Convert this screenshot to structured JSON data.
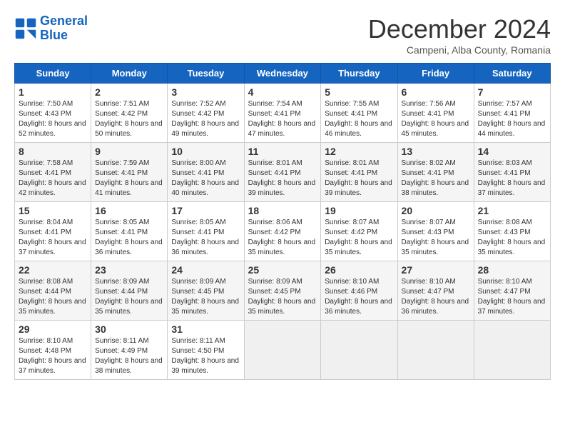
{
  "header": {
    "logo_line1": "General",
    "logo_line2": "Blue",
    "title": "December 2024",
    "subtitle": "Campeni, Alba County, Romania"
  },
  "weekdays": [
    "Sunday",
    "Monday",
    "Tuesday",
    "Wednesday",
    "Thursday",
    "Friday",
    "Saturday"
  ],
  "weeks": [
    [
      {
        "day": "1",
        "sunrise": "7:50 AM",
        "sunset": "4:43 PM",
        "daylight": "8 hours and 52 minutes."
      },
      {
        "day": "2",
        "sunrise": "7:51 AM",
        "sunset": "4:42 PM",
        "daylight": "8 hours and 50 minutes."
      },
      {
        "day": "3",
        "sunrise": "7:52 AM",
        "sunset": "4:42 PM",
        "daylight": "8 hours and 49 minutes."
      },
      {
        "day": "4",
        "sunrise": "7:54 AM",
        "sunset": "4:41 PM",
        "daylight": "8 hours and 47 minutes."
      },
      {
        "day": "5",
        "sunrise": "7:55 AM",
        "sunset": "4:41 PM",
        "daylight": "8 hours and 46 minutes."
      },
      {
        "day": "6",
        "sunrise": "7:56 AM",
        "sunset": "4:41 PM",
        "daylight": "8 hours and 45 minutes."
      },
      {
        "day": "7",
        "sunrise": "7:57 AM",
        "sunset": "4:41 PM",
        "daylight": "8 hours and 44 minutes."
      }
    ],
    [
      {
        "day": "8",
        "sunrise": "7:58 AM",
        "sunset": "4:41 PM",
        "daylight": "8 hours and 42 minutes."
      },
      {
        "day": "9",
        "sunrise": "7:59 AM",
        "sunset": "4:41 PM",
        "daylight": "8 hours and 41 minutes."
      },
      {
        "day": "10",
        "sunrise": "8:00 AM",
        "sunset": "4:41 PM",
        "daylight": "8 hours and 40 minutes."
      },
      {
        "day": "11",
        "sunrise": "8:01 AM",
        "sunset": "4:41 PM",
        "daylight": "8 hours and 39 minutes."
      },
      {
        "day": "12",
        "sunrise": "8:01 AM",
        "sunset": "4:41 PM",
        "daylight": "8 hours and 39 minutes."
      },
      {
        "day": "13",
        "sunrise": "8:02 AM",
        "sunset": "4:41 PM",
        "daylight": "8 hours and 38 minutes."
      },
      {
        "day": "14",
        "sunrise": "8:03 AM",
        "sunset": "4:41 PM",
        "daylight": "8 hours and 37 minutes."
      }
    ],
    [
      {
        "day": "15",
        "sunrise": "8:04 AM",
        "sunset": "4:41 PM",
        "daylight": "8 hours and 37 minutes."
      },
      {
        "day": "16",
        "sunrise": "8:05 AM",
        "sunset": "4:41 PM",
        "daylight": "8 hours and 36 minutes."
      },
      {
        "day": "17",
        "sunrise": "8:05 AM",
        "sunset": "4:41 PM",
        "daylight": "8 hours and 36 minutes."
      },
      {
        "day": "18",
        "sunrise": "8:06 AM",
        "sunset": "4:42 PM",
        "daylight": "8 hours and 35 minutes."
      },
      {
        "day": "19",
        "sunrise": "8:07 AM",
        "sunset": "4:42 PM",
        "daylight": "8 hours and 35 minutes."
      },
      {
        "day": "20",
        "sunrise": "8:07 AM",
        "sunset": "4:43 PM",
        "daylight": "8 hours and 35 minutes."
      },
      {
        "day": "21",
        "sunrise": "8:08 AM",
        "sunset": "4:43 PM",
        "daylight": "8 hours and 35 minutes."
      }
    ],
    [
      {
        "day": "22",
        "sunrise": "8:08 AM",
        "sunset": "4:44 PM",
        "daylight": "8 hours and 35 minutes."
      },
      {
        "day": "23",
        "sunrise": "8:09 AM",
        "sunset": "4:44 PM",
        "daylight": "8 hours and 35 minutes."
      },
      {
        "day": "24",
        "sunrise": "8:09 AM",
        "sunset": "4:45 PM",
        "daylight": "8 hours and 35 minutes."
      },
      {
        "day": "25",
        "sunrise": "8:09 AM",
        "sunset": "4:45 PM",
        "daylight": "8 hours and 35 minutes."
      },
      {
        "day": "26",
        "sunrise": "8:10 AM",
        "sunset": "4:46 PM",
        "daylight": "8 hours and 36 minutes."
      },
      {
        "day": "27",
        "sunrise": "8:10 AM",
        "sunset": "4:47 PM",
        "daylight": "8 hours and 36 minutes."
      },
      {
        "day": "28",
        "sunrise": "8:10 AM",
        "sunset": "4:47 PM",
        "daylight": "8 hours and 37 minutes."
      }
    ],
    [
      {
        "day": "29",
        "sunrise": "8:10 AM",
        "sunset": "4:48 PM",
        "daylight": "8 hours and 37 minutes."
      },
      {
        "day": "30",
        "sunrise": "8:11 AM",
        "sunset": "4:49 PM",
        "daylight": "8 hours and 38 minutes."
      },
      {
        "day": "31",
        "sunrise": "8:11 AM",
        "sunset": "4:50 PM",
        "daylight": "8 hours and 39 minutes."
      },
      null,
      null,
      null,
      null
    ]
  ]
}
